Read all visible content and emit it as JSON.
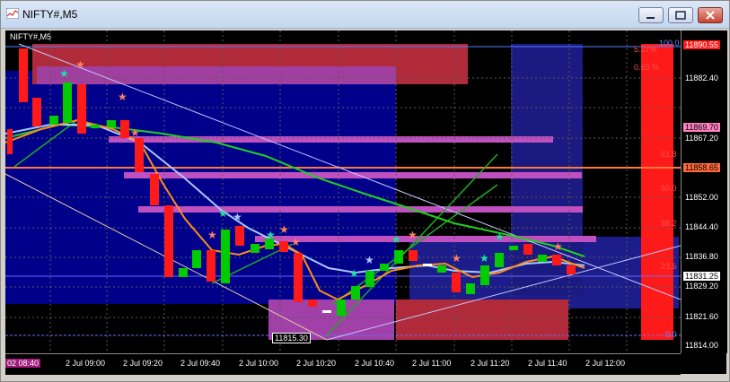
{
  "window": {
    "title": "NIFTY#,M5"
  },
  "chart": {
    "symbol_label": "NIFTY#,M5",
    "price_scale": [
      "11882.40",
      "11867.20",
      "11852.00",
      "11844.40",
      "11836.80",
      "11829.20",
      "11821.60",
      "11814.00"
    ],
    "price_tags": {
      "top": "11890.55",
      "magenta": "11869.70",
      "orange": "11858.65",
      "current": "11831.25"
    },
    "time_axis": [
      "02 08:40",
      "2 Jul 09:00",
      "2 Jul 09:20",
      "2 Jul 09:40",
      "2 Jul 10:00",
      "2 Jul 10:20",
      "2 Jul 10:40",
      "2 Jul 11:00",
      "2 Jul 11:20",
      "2 Jul 11:40",
      "2 Jul 12:00"
    ],
    "fib_levels": [
      "100.0",
      "61.8",
      "50.0",
      "38.2",
      "23.6",
      "0.0"
    ],
    "percent_labels": [
      "5.27%",
      "0.63 %"
    ],
    "low_label": "11815.30",
    "colors": {
      "background": "#000000",
      "bull": "#00cc00",
      "bear": "#ff1a1a",
      "ma_green": "#20d020",
      "ma_orange": "#ff8c1a",
      "ma_light": "#a8c8ff",
      "zone_blue": "#00008b",
      "zone_magenta": "#b040b0"
    }
  }
}
